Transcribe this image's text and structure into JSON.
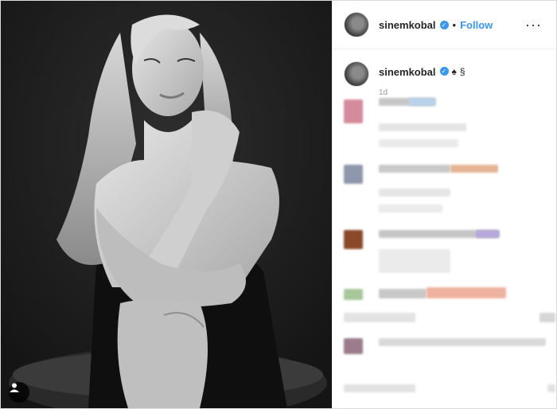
{
  "post": {
    "username": "sinemkobal",
    "follow_label": "Follow",
    "separator": "•",
    "more_label": "···",
    "caption_emoji": "♠",
    "caption_trailing": "§",
    "timestamp": "1d"
  },
  "colors": {
    "link": "#3897f0",
    "text": "#262626",
    "muted": "#999999",
    "border": "#dbdbdb",
    "photo_bg": "#1e1e1e"
  },
  "icons": {
    "verified": "verified-badge-icon",
    "more": "more-options-icon",
    "tag": "user-tag-icon"
  },
  "comments_note": "comments are pixelated in the screenshot"
}
